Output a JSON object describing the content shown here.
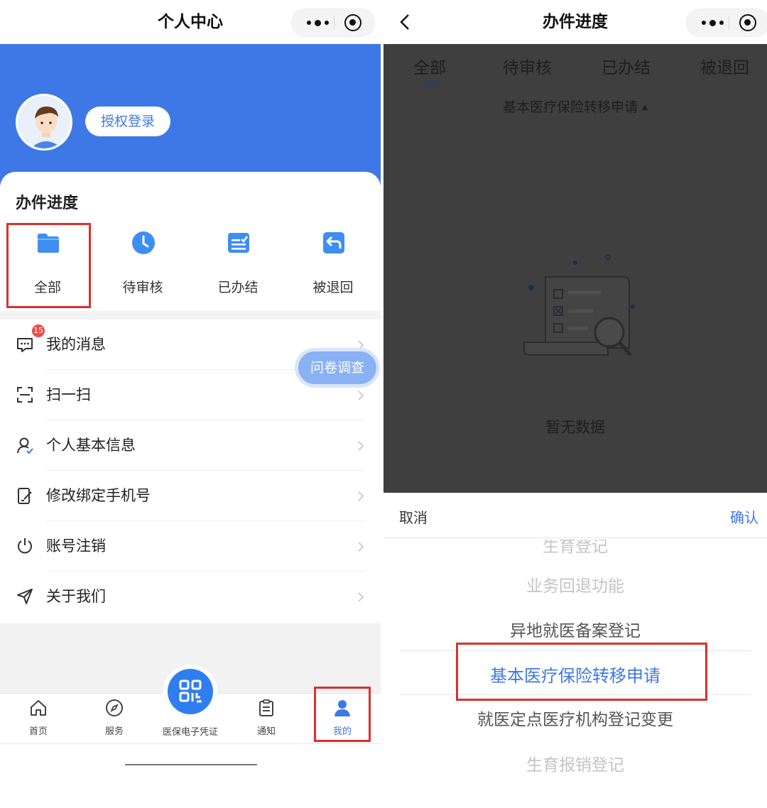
{
  "left": {
    "nav_title": "个人中心",
    "login_button": "授权登录",
    "progress_title": "办件进度",
    "progress_items": [
      {
        "label": "全部",
        "icon": "folder-icon"
      },
      {
        "label": "待审核",
        "icon": "clock-icon"
      },
      {
        "label": "已办结",
        "icon": "checklist-icon"
      },
      {
        "label": "被退回",
        "icon": "return-icon"
      }
    ],
    "message_badge": "15",
    "menu": [
      {
        "label": "我的消息",
        "icon": "message-icon"
      },
      {
        "label": "扫一扫",
        "icon": "scan-icon"
      },
      {
        "label": "个人基本信息",
        "icon": "user-icon"
      },
      {
        "label": "修改绑定手机号",
        "icon": "edit-phone-icon"
      },
      {
        "label": "账号注销",
        "icon": "power-icon"
      },
      {
        "label": "关于我们",
        "icon": "send-icon"
      }
    ],
    "survey_button": "问卷调查",
    "tabs": [
      {
        "label": "首页",
        "icon": "home-icon"
      },
      {
        "label": "服务",
        "icon": "compass-icon"
      },
      {
        "label": "医保电子凭证",
        "icon": "qr-icon"
      },
      {
        "label": "通知",
        "icon": "clipboard-icon"
      },
      {
        "label": "我的",
        "icon": "person-icon"
      }
    ],
    "active_tab": "我的"
  },
  "right": {
    "nav_title": "办件进度",
    "tabs": [
      "全部",
      "待审核",
      "已办结",
      "被退回"
    ],
    "active_tab": "全部",
    "filter_label": "基本医疗保险转移申请",
    "empty_text": "暂无数据",
    "cancel": "取消",
    "confirm": "确认",
    "picker_options": [
      "生育登记",
      "业务回退功能",
      "异地就医备案登记",
      "基本医疗保险转移申请",
      "就医定点医疗机构登记变更",
      "生育报销登记"
    ],
    "selected_option": "基本医疗保险转移申请"
  },
  "colors": {
    "brand_blue": "#3d78e6",
    "highlight_red": "#d9322f",
    "badge_red": "#ee4b4b",
    "overlay": "#3f3f3f"
  }
}
